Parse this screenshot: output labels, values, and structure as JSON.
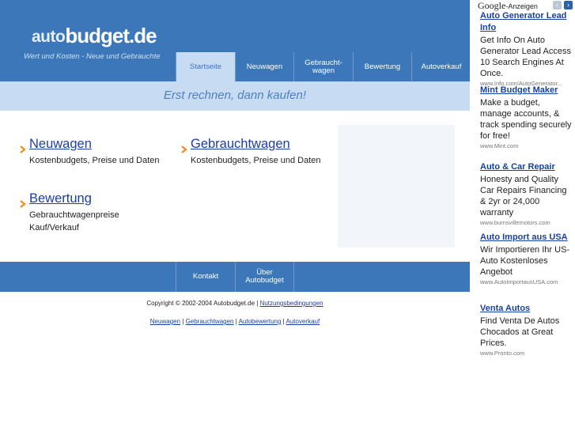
{
  "header": {
    "logo_auto": "auto",
    "logo_budget": "budget.de",
    "tagline": "Wert und Kosten - Neue und Gebrauchte",
    "tabs": [
      {
        "label": "Startseite"
      },
      {
        "label": "Neuwagen"
      },
      {
        "label": "Gebraucht-\nwagen"
      },
      {
        "label": "Bewertung"
      },
      {
        "label": "Autoverkauf"
      }
    ],
    "active_tab": "Startseite"
  },
  "slogan": "Erst rechnen, dann kaufen!",
  "sections": [
    {
      "title": "Neuwagen",
      "desc": "Kostenbudgets, Preise und Daten"
    },
    {
      "title": "Gebrauchtwagen",
      "desc": "Kostenbudgets, Preise und Daten"
    },
    {
      "title": "Bewertung",
      "desc": "Gebrauchtwagenpreise\nKauf/Verkauf"
    }
  ],
  "footer_nav": [
    {
      "label": "Kontakt"
    },
    {
      "label": "Über\nAutobudget"
    }
  ],
  "copyright": {
    "text": "Copyright © 2002-2004 Autobudget.de |",
    "terms_link": "Nutzungsbedingungen"
  },
  "footer_links": [
    "Neuwagen",
    "Gebrauchtwagen",
    "Autobewertung",
    "Autoverkauf"
  ],
  "footer_links_sep": "|",
  "ads": {
    "brand": "Google",
    "label": "-Anzeigen",
    "prev_icon": "chevron-left",
    "next_icon": "chevron-right",
    "items": [
      {
        "title": "Auto Generator Lead Info",
        "desc": "Get Info On Auto Generator Lead Access 10 Search Engines At Once.",
        "url": "www.Info.com/AutoGenerator..."
      },
      {
        "title": "Mint Budget Maker",
        "desc": "Make a budget, manage accounts, & track spending securely for free!",
        "url": "www.Mint.com"
      },
      {
        "title": "Auto & Car Repair",
        "desc": "Honesty and Quality Car Repairs Financing & 2yr or 24,000 warranty",
        "url": "www.burnsvillemotors.com"
      },
      {
        "title": "Auto Import aus USA",
        "desc": "Wir Importieren Ihr US-Auto Kostenloses Angebot",
        "url": "www.AutoImportausUSA.com"
      },
      {
        "title": "Venta Autos",
        "desc": "Find Venta De Autos Chocados at Great Prices.",
        "url": "www.Pronto.com"
      }
    ]
  },
  "colors": {
    "brand_blue": "#3c77ba",
    "light_band": "#c7dcf2",
    "link": "#1a3fa3",
    "bullet": "#f08c1e"
  }
}
